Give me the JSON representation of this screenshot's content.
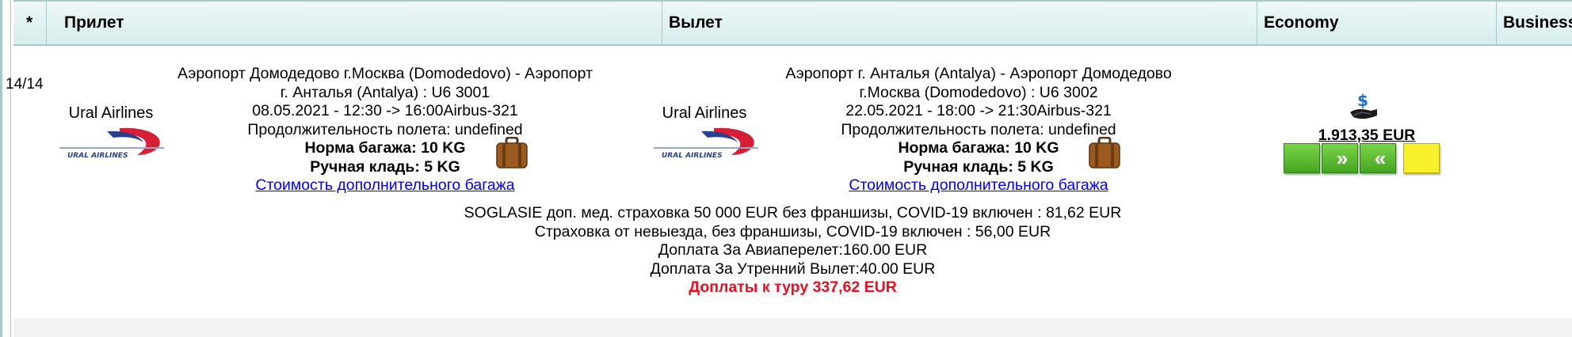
{
  "header": {
    "col_star": "*",
    "col_arrival": "Прилет",
    "col_departure": "Вылет",
    "col_economy": "Economy",
    "col_business": "Business"
  },
  "row": {
    "index": "14/14",
    "outbound": {
      "airline": "Ural Airlines",
      "route_line1": "Аэропорт Домодедово г.Москва (Domodedovo) - Аэропорт",
      "route_line2": "г. Анталья (Antalya) : U6 3001",
      "datetime": "08.05.2021 - 12:30 -> 16:00Airbus-321",
      "duration": "Продолжительность полета: undefined",
      "baggage": "Норма багажа: 10 KG",
      "hand_luggage": "Ручная кладь: 5 KG",
      "extra_baggage_link": "Стоимость дополнительного багажа"
    },
    "return": {
      "airline": "Ural Airlines",
      "route_line1": "Аэропорт г. Анталья (Antalya) - Аэропорт Домодедово",
      "route_line2": "г.Москва (Domodedovo) : U6 3002",
      "datetime": "22.05.2021 - 18:00 -> 21:30Airbus-321",
      "duration": "Продолжительность полета: undefined",
      "baggage": "Норма багажа: 10 KG",
      "hand_luggage": "Ручная кладь: 5 KG",
      "extra_baggage_link": "Стоимость дополнительного багажа"
    },
    "economy_price": "1.913,35 EUR",
    "extras": [
      "SOGLASIE доп. мед. страховка 50 000 EUR без франшизы, COVID-19 включен : 81,62 EUR",
      "Страховка от невыезда, без франшизы, COVID-19 включен : 56,00 EUR",
      "Доплата За Авиаперелет:160.00 EUR",
      "Доплата За Утренний Вылет:40.00 EUR"
    ],
    "extras_total": "Доплаты к туру 337,62 EUR"
  },
  "colors": {
    "header_bg": "#d6ecec",
    "border": "#a9c9c9",
    "link": "#0000ee",
    "total_red": "#e8101e",
    "button_green": "#45a51f",
    "button_yellow": "#f7f02a"
  },
  "icons": [
    "ural-airlines-logo",
    "suitcase-icon",
    "money-hand-icon",
    "forward-arrows-icon",
    "back-arrows-icon"
  ]
}
